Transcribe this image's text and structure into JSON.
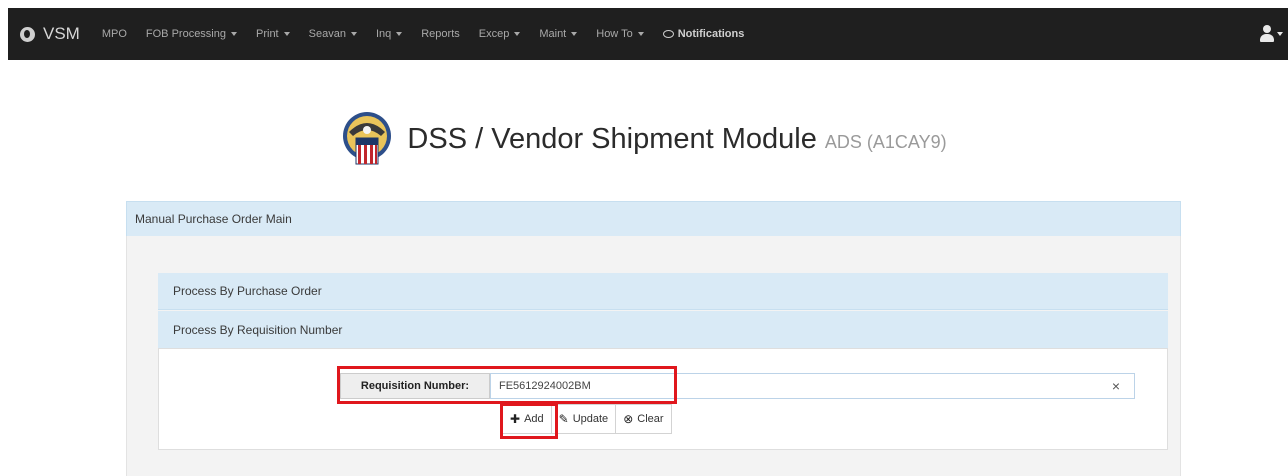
{
  "navbar": {
    "brand": "VSM",
    "items": [
      {
        "label": "MPO",
        "dropdown": false
      },
      {
        "label": "FOB Processing",
        "dropdown": true
      },
      {
        "label": "Print",
        "dropdown": true
      },
      {
        "label": "Seavan",
        "dropdown": true
      },
      {
        "label": "Inq",
        "dropdown": true
      },
      {
        "label": "Reports",
        "dropdown": false
      },
      {
        "label": "Excep",
        "dropdown": true
      },
      {
        "label": "Maint",
        "dropdown": true
      },
      {
        "label": "How To",
        "dropdown": true
      }
    ],
    "notifications_label": "Notifications",
    "user_icon": "user-icon"
  },
  "header": {
    "title": "DSS / Vendor Shipment Module",
    "subtitle": "ADS (A1CAY9)"
  },
  "panel": {
    "title": "Manual Purchase Order Main",
    "sections": [
      {
        "label": "Process By Purchase Order"
      },
      {
        "label": "Process By Requisition Number"
      }
    ]
  },
  "form": {
    "req_label": "Requisition Number:",
    "req_value": "FE5612924002BM",
    "clear_glyph": "×",
    "buttons": {
      "add": "Add",
      "update": "Update",
      "clear": "Clear"
    }
  },
  "colors": {
    "navbar_bg": "#1f1f1f",
    "panel_header_bg": "#d9eaf6",
    "highlight": "#e0171d"
  }
}
